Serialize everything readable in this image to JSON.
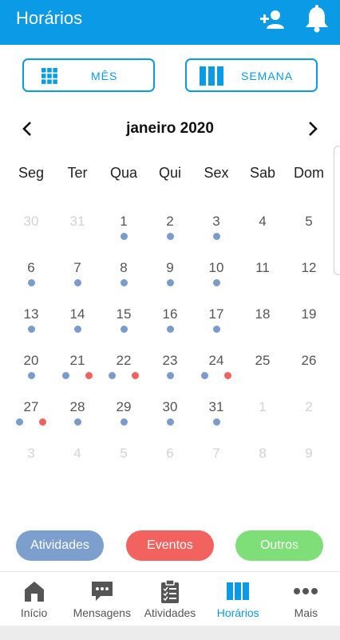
{
  "header": {
    "title": "Horários"
  },
  "toggles": {
    "month_label": "MÊS",
    "week_label": "SEMANA"
  },
  "calendar": {
    "month_title": "janeiro 2020",
    "weekdays": [
      "Seg",
      "Ter",
      "Qua",
      "Qui",
      "Sex",
      "Sab",
      "Dom"
    ],
    "weeks": [
      [
        {
          "d": "30",
          "faded": true,
          "dots": []
        },
        {
          "d": "31",
          "faded": true,
          "dots": []
        },
        {
          "d": "1",
          "dots": [
            "blue"
          ]
        },
        {
          "d": "2",
          "dots": [
            "blue"
          ]
        },
        {
          "d": "3",
          "dots": [
            "blue"
          ]
        },
        {
          "d": "4",
          "dots": []
        },
        {
          "d": "5",
          "dots": []
        }
      ],
      [
        {
          "d": "6",
          "dots": [
            "blue"
          ]
        },
        {
          "d": "7",
          "dots": [
            "blue"
          ]
        },
        {
          "d": "8",
          "dots": [
            "blue"
          ]
        },
        {
          "d": "9",
          "dots": [
            "blue"
          ]
        },
        {
          "d": "10",
          "dots": [
            "blue"
          ]
        },
        {
          "d": "11",
          "dots": []
        },
        {
          "d": "12",
          "dots": []
        }
      ],
      [
        {
          "d": "13",
          "dots": [
            "blue"
          ]
        },
        {
          "d": "14",
          "dots": [
            "blue"
          ]
        },
        {
          "d": "15",
          "dots": [
            "blue"
          ]
        },
        {
          "d": "16",
          "dots": [
            "blue"
          ]
        },
        {
          "d": "17",
          "dots": [
            "blue"
          ]
        },
        {
          "d": "18",
          "dots": []
        },
        {
          "d": "19",
          "dots": []
        }
      ],
      [
        {
          "d": "20",
          "dots": [
            "blue"
          ]
        },
        {
          "d": "21",
          "dots": [
            "blue",
            "red"
          ]
        },
        {
          "d": "22",
          "dots": [
            "blue",
            "red"
          ]
        },
        {
          "d": "23",
          "dots": [
            "blue"
          ]
        },
        {
          "d": "24",
          "dots": [
            "blue",
            "red"
          ]
        },
        {
          "d": "25",
          "dots": []
        },
        {
          "d": "26",
          "dots": []
        }
      ],
      [
        {
          "d": "27",
          "dots": [
            "blue",
            "red"
          ]
        },
        {
          "d": "28",
          "dots": [
            "blue"
          ]
        },
        {
          "d": "29",
          "dots": [
            "blue"
          ]
        },
        {
          "d": "30",
          "dots": [
            "blue"
          ]
        },
        {
          "d": "31",
          "dots": [
            "blue"
          ]
        },
        {
          "d": "1",
          "faded": true,
          "dots": []
        },
        {
          "d": "2",
          "faded": true,
          "dots": []
        }
      ],
      [
        {
          "d": "3",
          "faded": true,
          "dots": []
        },
        {
          "d": "4",
          "faded": true,
          "dots": []
        },
        {
          "d": "5",
          "faded": true,
          "dots": []
        },
        {
          "d": "6",
          "faded": true,
          "dots": []
        },
        {
          "d": "7",
          "faded": true,
          "dots": []
        },
        {
          "d": "8",
          "faded": true,
          "dots": []
        },
        {
          "d": "9",
          "faded": true,
          "dots": []
        }
      ]
    ]
  },
  "legend": {
    "activities": "Atividades",
    "events": "Eventos",
    "others": "Outros"
  },
  "colors": {
    "accent": "#0a9ae6",
    "activities": "#7c9fcd",
    "events": "#f2625e",
    "others": "#7ede78"
  },
  "nav": {
    "items": [
      {
        "label": "Início",
        "icon": "home-icon"
      },
      {
        "label": "Mensagens",
        "icon": "chat-icon"
      },
      {
        "label": "Atividades",
        "icon": "clipboard-icon"
      },
      {
        "label": "Horários",
        "icon": "schedule-icon",
        "active": true
      },
      {
        "label": "Mais",
        "icon": "more-icon"
      }
    ]
  }
}
